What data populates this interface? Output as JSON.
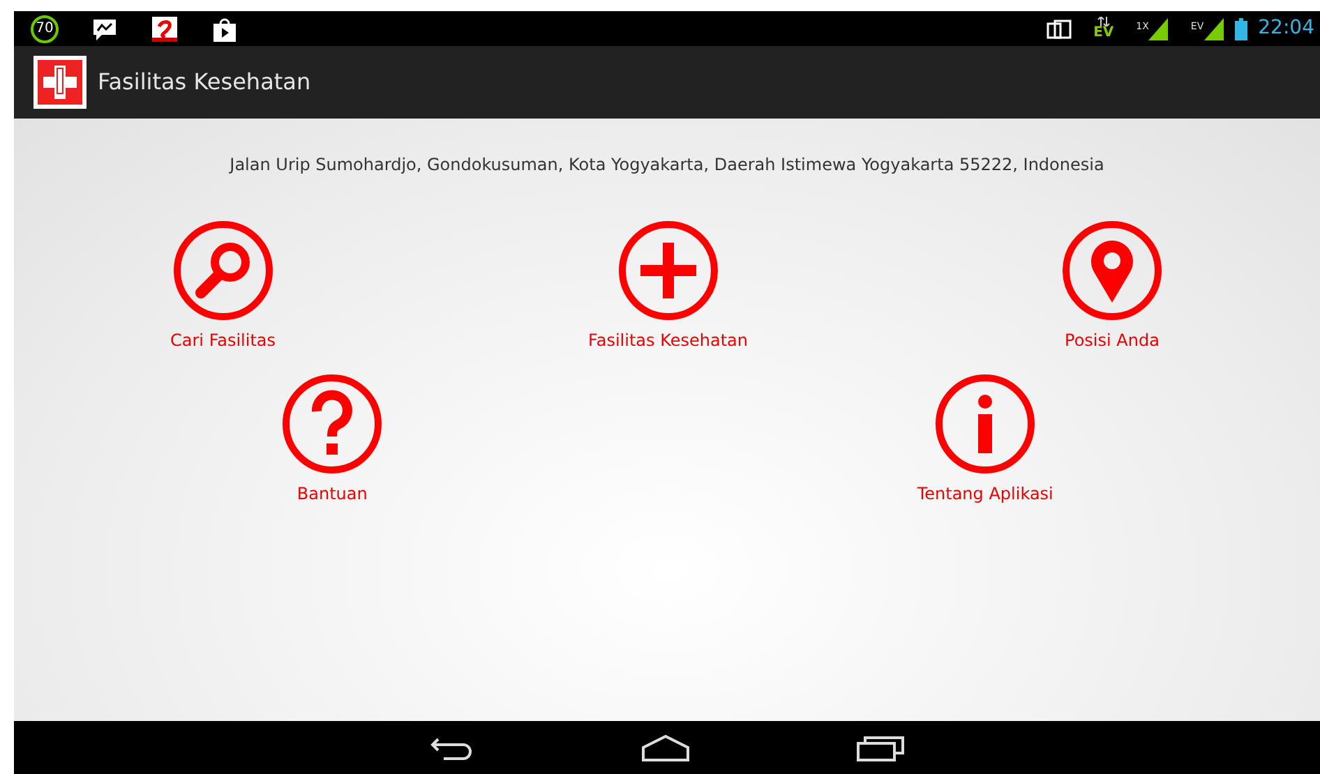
{
  "status_bar": {
    "counter": "70",
    "data_label": "EV",
    "signal_labels": [
      "1X",
      "EV"
    ],
    "time": "22:04"
  },
  "app_bar": {
    "title": "Fasilitas Kesehatan"
  },
  "address": "Jalan Urip Sumohardjo, Gondokusuman, Kota Yogyakarta, Daerah Istimewa Yogyakarta 55222, Indonesia",
  "menu_rows": [
    [
      {
        "kind": "search",
        "label": "Cari Fasilitas"
      },
      {
        "kind": "plus",
        "label": "Fasilitas Kesehatan"
      },
      {
        "kind": "pin",
        "label": "Posisi Anda"
      }
    ],
    [
      {
        "kind": "help",
        "label": "Bantuan"
      },
      {
        "kind": "info",
        "label": "Tentang Aplikasi"
      }
    ]
  ]
}
